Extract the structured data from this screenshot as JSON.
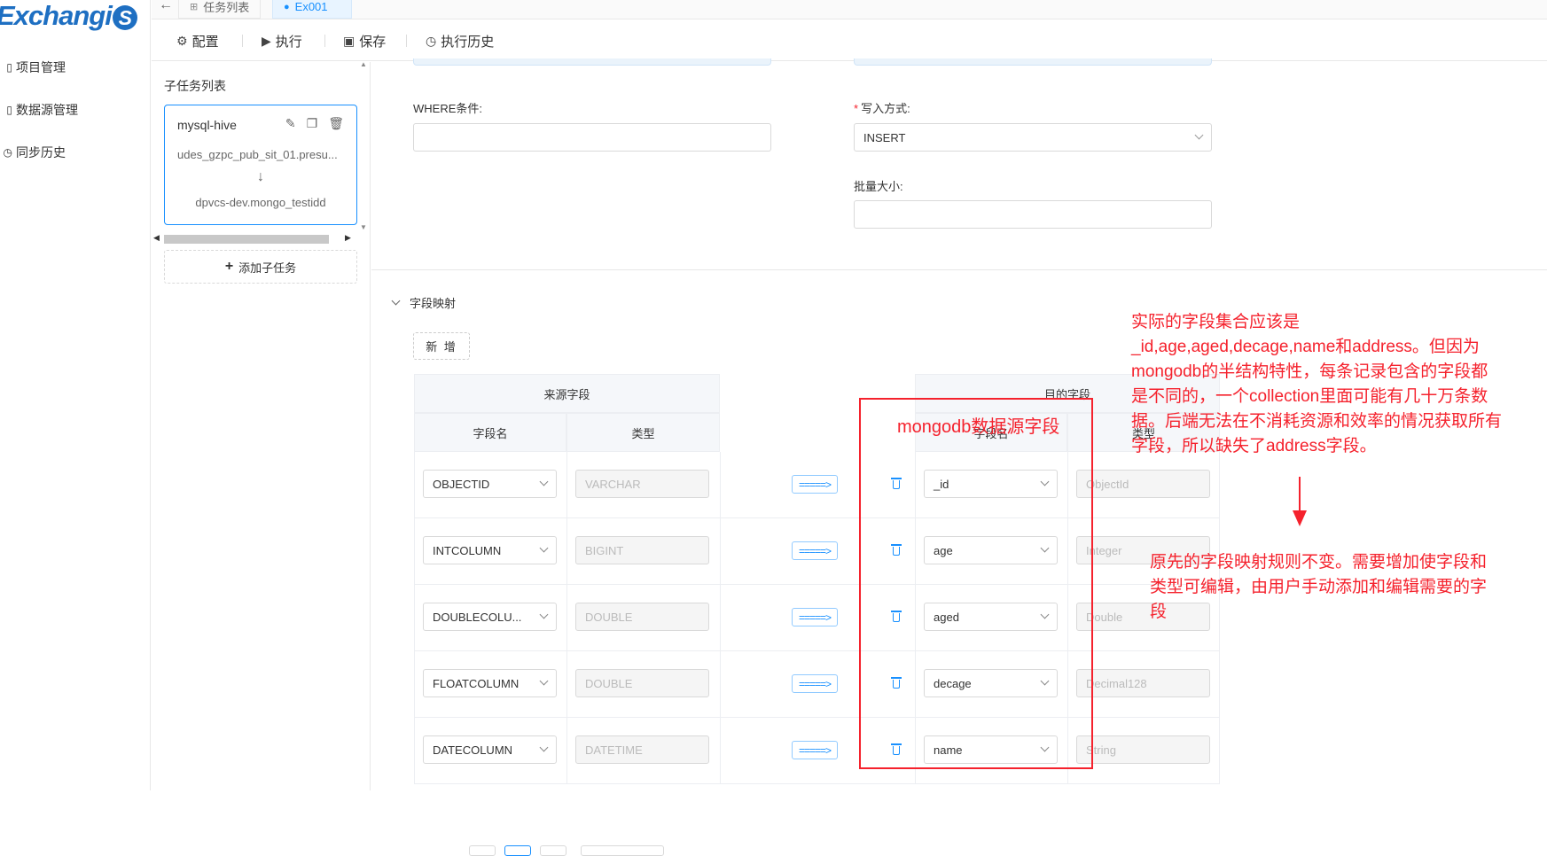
{
  "app": {
    "logo_text": "Exchangi",
    "logo_badge": "S"
  },
  "sidebar": {
    "items": [
      {
        "label": "项目管理",
        "icon": "project-icon"
      },
      {
        "label": "数据源管理",
        "icon": "datasource-icon"
      },
      {
        "label": "同步历史",
        "icon": "history-icon"
      }
    ]
  },
  "tabs": [
    {
      "label": "任务列表",
      "icon": "sitemap-icon"
    },
    {
      "label": "Ex001",
      "icon": "task-icon",
      "active": true
    }
  ],
  "toolbar": {
    "config": "配置",
    "run": "执行",
    "save": "保存",
    "history": "执行历史"
  },
  "subtasks": {
    "title": "子任务列表",
    "card": {
      "name": "mysql-hive",
      "source": "udes_gzpc_pub_sit_01.presu...",
      "target": "dpvcs-dev.mongo_testidd"
    },
    "add_label": "添加子任务"
  },
  "form": {
    "where_label": "WHERE条件:",
    "where_value": "",
    "write_mode_label": "写入方式:",
    "write_mode_value": "INSERT",
    "batch_label": "批量大小:",
    "batch_value": ""
  },
  "mapping": {
    "section_title": "字段映射",
    "add_label": "新 增",
    "source_group": "来源字段",
    "target_group": "目的字段",
    "col_name": "字段名",
    "col_type": "类型",
    "rows": [
      {
        "src_name": "OBJECTID",
        "src_type": "VARCHAR",
        "map": "=====>",
        "dst_name": "_id",
        "dst_type": "ObjectId"
      },
      {
        "src_name": "INTCOLUMN",
        "src_type": "BIGINT",
        "map": "=====>",
        "dst_name": "age",
        "dst_type": "Integer"
      },
      {
        "src_name": "DOUBLECOLU...",
        "src_type": "DOUBLE",
        "map": "=====>",
        "dst_name": "aged",
        "dst_type": "Double"
      },
      {
        "src_name": "FLOATCOLUMN",
        "src_type": "DOUBLE",
        "map": "=====>",
        "dst_name": "decage",
        "dst_type": "Decimal128"
      },
      {
        "src_name": "DATECOLUMN",
        "src_type": "DATETIME",
        "map": "=====>",
        "dst_name": "name",
        "dst_type": "String"
      }
    ]
  },
  "annotations": {
    "box_label": "mongodb数据源字段",
    "note1_lines": [
      "实际的字段集合应该是",
      "_id,age,aged,decage,name和address。但因为",
      "mongodb的半结构特性，每条记录包含的字段都",
      "是不同的，一个collection里面可能有几十万条数",
      "据。后端无法在不消耗资源和效率的情况获取所有",
      "字段，所以缺失了address字段。"
    ],
    "note2_lines": [
      "原先的字段映射规则不变。需要增加使字段和",
      "类型可编辑，由用户手动添加和编辑需要的字",
      "段"
    ],
    "color": "#f5222d"
  }
}
